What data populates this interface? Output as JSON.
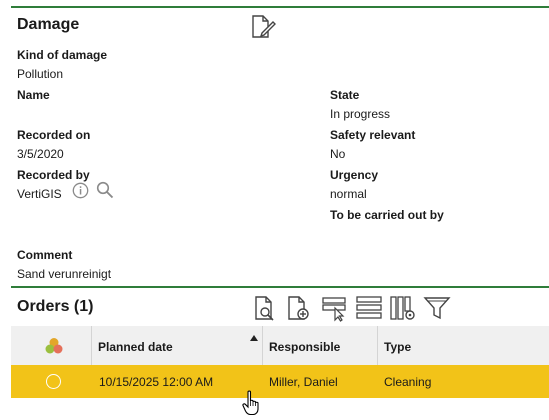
{
  "damage": {
    "title": "Damage",
    "fields": {
      "kind_label": "Kind of damage",
      "kind_value": "Pollution",
      "name_label": "Name",
      "state_label": "State",
      "state_value": "In progress",
      "recorded_on_label": "Recorded on",
      "recorded_on_value": "3/5/2020",
      "safety_label": "Safety relevant",
      "safety_value": "No",
      "recorded_by_label": "Recorded by",
      "recorded_by_value": "VertiGIS",
      "urgency_label": "Urgency",
      "urgency_value": "normal",
      "carried_out_label": "To be carried out by",
      "comment_label": "Comment",
      "comment_value": "Sand verunreinigt"
    }
  },
  "orders": {
    "title": "Orders (1)",
    "columns": {
      "planned_date": "Planned date",
      "responsible": "Responsible",
      "type": "Type"
    },
    "rows": [
      {
        "planned_date": "10/15/2025 12:00 AM",
        "responsible": "Miller, Daniel",
        "type": "Cleaning"
      }
    ]
  },
  "colors": {
    "accent_green": "#2f7d3a",
    "selected_row": "#f2c318",
    "header_bg": "#f0f0f0"
  }
}
